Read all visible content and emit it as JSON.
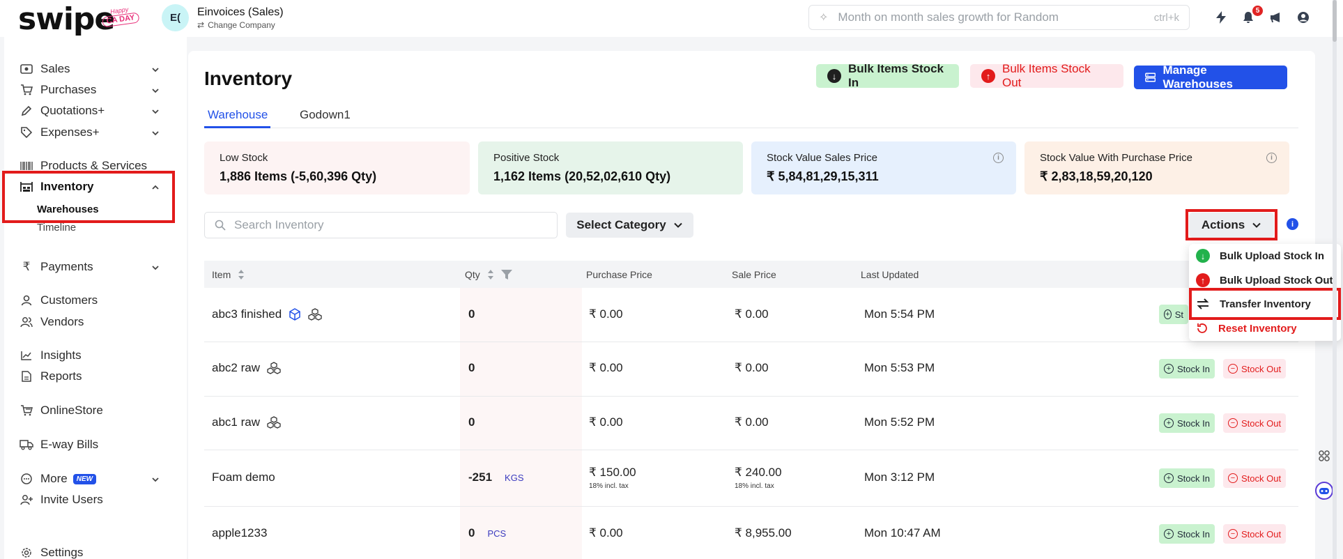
{
  "brand": {
    "logo": "swipe",
    "badge_top": "Happy",
    "badge_bottom": "CA DAY"
  },
  "company": {
    "initials": "E(",
    "name": "Einvoices (Sales)",
    "change": "Change Company"
  },
  "search": {
    "placeholder": "Month on month sales growth for Random",
    "shortcut": "ctrl+k"
  },
  "notifications": {
    "count": "5"
  },
  "sidebar": {
    "items": [
      {
        "label": "Sales",
        "icon": "cash-icon"
      },
      {
        "label": "Purchases",
        "icon": "cart-icon"
      },
      {
        "label": "Quotations+",
        "icon": "pen-icon"
      },
      {
        "label": "Expenses+",
        "icon": "tag-icon"
      },
      {
        "label": "Products & Services",
        "icon": "barcode-icon"
      },
      {
        "label": "Inventory",
        "icon": "warehouse-icon"
      },
      {
        "label": "Payments",
        "icon": "rupee-icon"
      },
      {
        "label": "Customers",
        "icon": "user-icon"
      },
      {
        "label": "Vendors",
        "icon": "users-icon"
      },
      {
        "label": "Insights",
        "icon": "chart-icon"
      },
      {
        "label": "Reports",
        "icon": "report-icon"
      },
      {
        "label": "OnlineStore",
        "icon": "store-icon"
      },
      {
        "label": "E-way Bills",
        "icon": "truck-icon"
      },
      {
        "label": "More",
        "icon": "more-icon",
        "badge": "NEW"
      },
      {
        "label": "Invite Users",
        "icon": "add-user-icon"
      },
      {
        "label": "Settings",
        "icon": "gear-icon"
      }
    ],
    "inventory_sub": [
      "Warehouses",
      "Timeline"
    ]
  },
  "page": {
    "title": "Inventory"
  },
  "buttons": {
    "stock_in": "Bulk Items Stock In",
    "stock_out": "Bulk Items Stock Out",
    "manage": "Manage Warehouses"
  },
  "tabs": [
    "Warehouse",
    "Godown1"
  ],
  "cards": [
    {
      "label": "Low Stock",
      "value": "1,886 Items (-5,60,396 Qty)",
      "color": "#fdf3f3"
    },
    {
      "label": "Positive Stock",
      "value": "1,162 Items (20,52,02,610 Qty)",
      "color": "#e6f4ea"
    },
    {
      "label": "Stock Value Sales Price",
      "value": "₹ 5,84,81,29,15,311",
      "color": "#e6f0fd"
    },
    {
      "label": "Stock Value With Purchase Price",
      "value": "₹ 2,83,18,59,20,120",
      "color": "#fdf0e6"
    }
  ],
  "inventory_search": {
    "placeholder": "Search Inventory"
  },
  "select_category": "Select Category",
  "actions_label": "Actions",
  "table": {
    "headers": [
      "Item",
      "Qty",
      "Purchase Price",
      "Sale Price",
      "Last Updated"
    ],
    "rows": [
      {
        "item": "abc3 finished",
        "qty": "0",
        "unit": "",
        "purchase": "₹ 0.00",
        "purchase_tax": "",
        "sale": "₹ 0.00",
        "sale_tax": "",
        "updated": "Mon 5:54 PM"
      },
      {
        "item": "abc2 raw",
        "qty": "0",
        "unit": "",
        "purchase": "₹ 0.00",
        "purchase_tax": "",
        "sale": "₹ 0.00",
        "sale_tax": "",
        "updated": "Mon 5:53 PM"
      },
      {
        "item": "abc1 raw",
        "qty": "0",
        "unit": "",
        "purchase": "₹ 0.00",
        "purchase_tax": "",
        "sale": "₹ 0.00",
        "sale_tax": "",
        "updated": "Mon 5:52 PM"
      },
      {
        "item": "Foam demo",
        "qty": "-251",
        "unit": "KGS",
        "purchase": "₹ 150.00",
        "purchase_tax": "18% incl. tax",
        "sale": "₹ 240.00",
        "sale_tax": "18% incl. tax",
        "updated": "Mon 3:12 PM"
      },
      {
        "item": "apple1233",
        "qty": "0",
        "unit": "PCS",
        "purchase": "₹ 0.00",
        "purchase_tax": "",
        "sale": "₹ 8,955.00",
        "sale_tax": "",
        "updated": "Mon 10:47 AM"
      }
    ],
    "stock_in": "Stock In",
    "stock_in_partial": "St",
    "stock_out": "Stock Out"
  },
  "actions_menu": [
    "Bulk Upload Stock In",
    "Bulk Upload Stock Out",
    "Transfer Inventory",
    "Reset Inventory"
  ],
  "colors": {
    "accent": "#2251e8",
    "danger": "#e21b1b",
    "success_bg": "#c9f2cf",
    "highlight": "#e21b1b"
  }
}
